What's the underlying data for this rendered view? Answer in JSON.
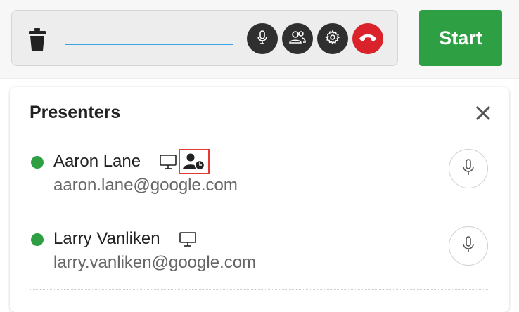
{
  "toolbar": {
    "name_value": "",
    "start_label": "Start",
    "hangup_color": "#d9222a",
    "start_color": "#2ea043",
    "icons": [
      "trash-icon",
      "mic-icon",
      "people-icon",
      "gear-icon",
      "phone-hangup-icon"
    ]
  },
  "panel": {
    "title": "Presenters",
    "close_icon": "close-icon",
    "presenters": [
      {
        "name": "Aaron Lane",
        "email": "aaron.lane@google.com",
        "status": "online",
        "icons": [
          "monitor-icon",
          "user-clock-icon"
        ]
      },
      {
        "name": "Larry Vanliken",
        "email": "larry.vanliken@google.com",
        "status": "online",
        "icons": [
          "monitor-icon"
        ]
      }
    ]
  }
}
